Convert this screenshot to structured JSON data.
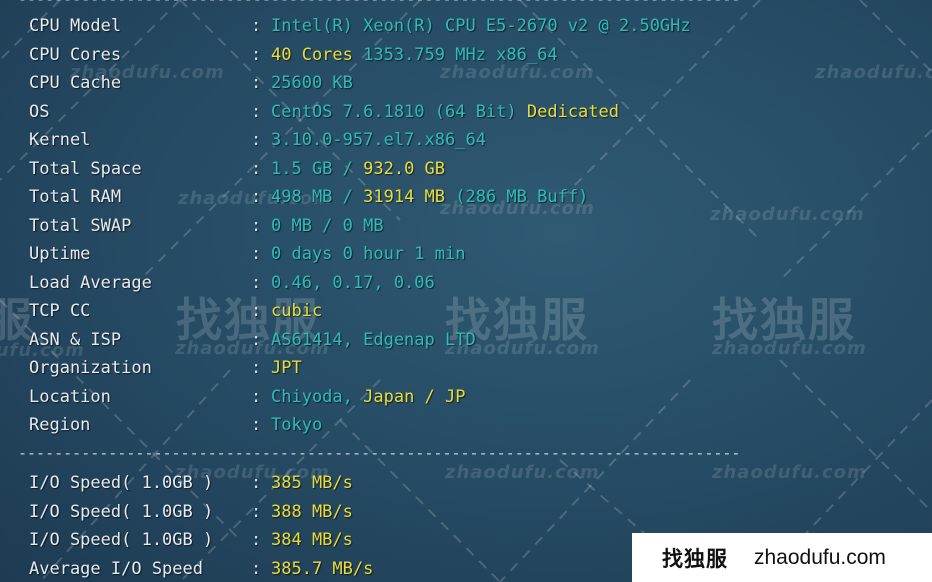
{
  "separator": "--------------------------------------------------------------------------------",
  "system_info": [
    {
      "label": "CPU Model",
      "parts": [
        {
          "text": "Intel(R) Xeon(R) CPU E5-2670 v2 @ 2.50GHz",
          "color": "cyan"
        }
      ]
    },
    {
      "label": "CPU Cores",
      "parts": [
        {
          "text": "40 Cores",
          "color": "yellow"
        },
        {
          "text": " 1353.759 MHz x86_64",
          "color": "cyan"
        }
      ]
    },
    {
      "label": "CPU Cache",
      "parts": [
        {
          "text": "25600 KB",
          "color": "cyan"
        }
      ]
    },
    {
      "label": "OS",
      "parts": [
        {
          "text": "CentOS 7.6.1810 (64 Bit)",
          "color": "cyan"
        },
        {
          "text": " Dedicated",
          "color": "yellow"
        }
      ]
    },
    {
      "label": "Kernel",
      "parts": [
        {
          "text": "3.10.0-957.el7.x86_64",
          "color": "cyan"
        }
      ]
    },
    {
      "label": "Total Space",
      "parts": [
        {
          "text": "1.5 GB / ",
          "color": "cyan"
        },
        {
          "text": "932.0 GB",
          "color": "yellow"
        }
      ]
    },
    {
      "label": "Total RAM",
      "parts": [
        {
          "text": "498 MB / ",
          "color": "cyan"
        },
        {
          "text": "31914 MB",
          "color": "yellow"
        },
        {
          "text": " (286 MB Buff)",
          "color": "cyan"
        }
      ]
    },
    {
      "label": "Total SWAP",
      "parts": [
        {
          "text": "0 MB / 0 MB",
          "color": "cyan"
        }
      ]
    },
    {
      "label": "Uptime",
      "parts": [
        {
          "text": "0 days 0 hour 1 min",
          "color": "cyan"
        }
      ]
    },
    {
      "label": "Load Average",
      "parts": [
        {
          "text": "0.46, 0.17, 0.06",
          "color": "cyan"
        }
      ]
    },
    {
      "label": "TCP CC",
      "parts": [
        {
          "text": "cubic",
          "color": "yellow"
        }
      ]
    },
    {
      "label": "ASN & ISP",
      "parts": [
        {
          "text": "AS61414, Edgenap LTD",
          "color": "cyan"
        }
      ]
    },
    {
      "label": "Organization",
      "parts": [
        {
          "text": "JPT",
          "color": "yellow"
        }
      ]
    },
    {
      "label": "Location",
      "parts": [
        {
          "text": "Chiyoda,",
          "color": "cyan"
        },
        {
          "text": " Japan / JP",
          "color": "yellow"
        }
      ]
    },
    {
      "label": "Region",
      "parts": [
        {
          "text": "Tokyo",
          "color": "cyan"
        }
      ]
    }
  ],
  "io_results": [
    {
      "label": "I/O Speed( 1.0GB )",
      "value": "385 MB/s"
    },
    {
      "label": "I/O Speed( 1.0GB )",
      "value": "388 MB/s"
    },
    {
      "label": "I/O Speed( 1.0GB )",
      "value": "384 MB/s"
    },
    {
      "label": "Average I/O Speed",
      "value": "385.7 MB/s"
    }
  ],
  "colon": ":",
  "colors": {
    "cyan": "#2fbcb8",
    "yellow": "#e9dc3a",
    "label": "#e6ebef",
    "background": "#274d66"
  },
  "watermark": {
    "cn": "找独服",
    "en": "zhaodufu.com"
  },
  "badge": {
    "cn": "找独服",
    "en": "zhaodufu.com"
  }
}
